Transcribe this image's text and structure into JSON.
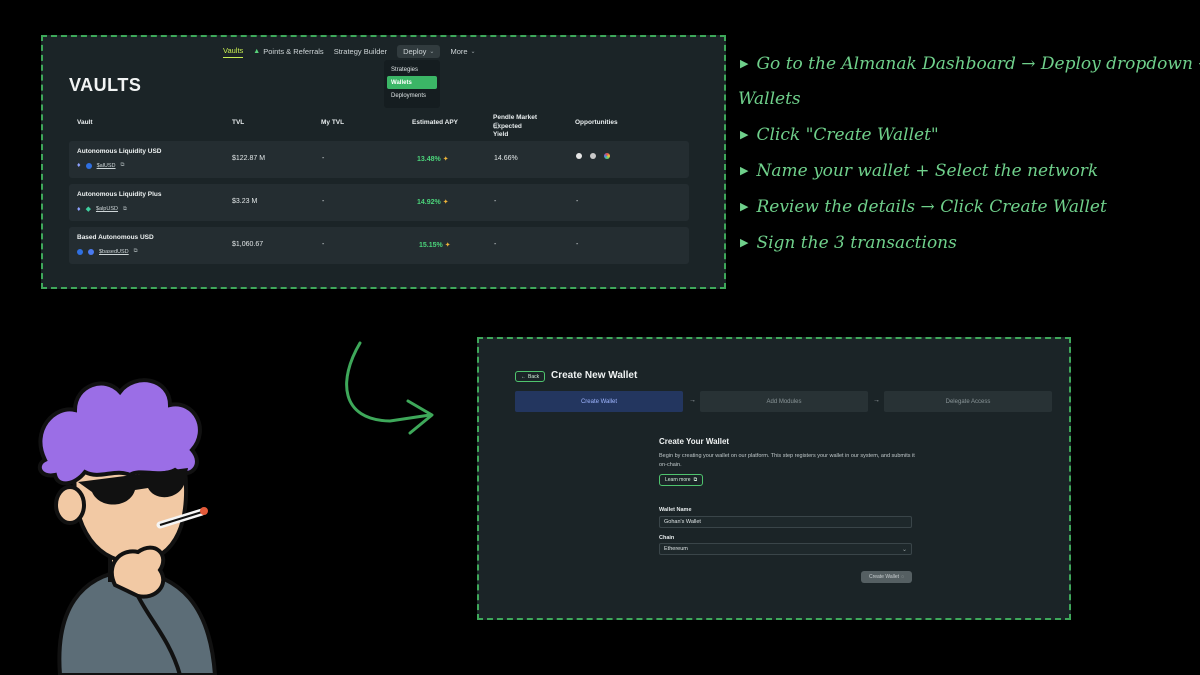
{
  "vaults_screen": {
    "nav": {
      "vaults": "Vaults",
      "points": "Points & Referrals",
      "strategy": "Strategy Builder",
      "deploy": "Deploy",
      "more": "More"
    },
    "deploy_menu": {
      "items": [
        "Strategies",
        "Wallets",
        "Deployments"
      ],
      "selected": "Wallets"
    },
    "title": "VAULTS",
    "columns": {
      "vault": "Vault",
      "tvl": "TVL",
      "my_tvl": "My TVL",
      "apy": "Estimated APY",
      "pendle_1": "Pendle Market",
      "pendle_2": "Expected Yield",
      "opportunities": "Opportunities"
    },
    "rows": [
      {
        "name": "Autonomous Liquidity USD",
        "token": "$alUSD",
        "tvl": "$122.87 M",
        "my_tvl": "-",
        "apy": "13.48%",
        "pendle": "14.66%",
        "opps": ""
      },
      {
        "name": "Autonomous Liquidity Plus",
        "token": "$alpUSD",
        "tvl": "$3.23 M",
        "my_tvl": "-",
        "apy": "14.92%",
        "pendle": "-",
        "opps": "-"
      },
      {
        "name": "Based Autonomous USD",
        "token": "$basedUSD",
        "tvl": "$1,060.67",
        "my_tvl": "-",
        "apy": "15.15%",
        "pendle": "-",
        "opps": "-"
      }
    ]
  },
  "instructions": [
    "Go to the Almanak Dashboard → Deploy dropdown →",
    "Wallets",
    "Click \"Create Wallet\"",
    "Name your wallet + Select the network",
    "Review the details → Click Create Wallet",
    "Sign the 3 transactions"
  ],
  "wallet_screen": {
    "back": "Back",
    "title": "Create New Wallet",
    "steps": [
      "Create Wallet",
      "Add Modules",
      "Delegate Access"
    ],
    "heading": "Create Your Wallet",
    "description": "Begin by creating your wallet on our platform. This step registers your wallet in our system, and submits it on-chain.",
    "learn_more": "Learn more",
    "wallet_name_label": "Wallet Name",
    "wallet_name_value": "Gohan's Wallet",
    "chain_label": "Chain",
    "chain_value": "Ethereum",
    "submit": "Create Wallet"
  },
  "colors": {
    "accent_green": "#3ea85a",
    "lime": "#c8ee52",
    "panel_bg": "#1b2427",
    "step_active": "#23365f"
  }
}
